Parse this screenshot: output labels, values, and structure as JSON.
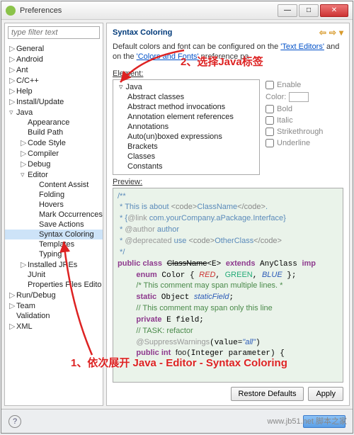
{
  "window": {
    "title": "Preferences"
  },
  "filter": {
    "placeholder": "type filter text"
  },
  "tree": [
    {
      "d": 1,
      "a": "▷",
      "t": "General"
    },
    {
      "d": 1,
      "a": "▷",
      "t": "Android"
    },
    {
      "d": 1,
      "a": "▷",
      "t": "Ant"
    },
    {
      "d": 1,
      "a": "▷",
      "t": "C/C++"
    },
    {
      "d": 1,
      "a": "▷",
      "t": "Help"
    },
    {
      "d": 1,
      "a": "▷",
      "t": "Install/Update"
    },
    {
      "d": 1,
      "a": "▿",
      "t": "Java"
    },
    {
      "d": 2,
      "a": "",
      "t": "Appearance"
    },
    {
      "d": 2,
      "a": "",
      "t": "Build Path"
    },
    {
      "d": 2,
      "a": "▷",
      "t": "Code Style"
    },
    {
      "d": 2,
      "a": "▷",
      "t": "Compiler"
    },
    {
      "d": 2,
      "a": "▷",
      "t": "Debug"
    },
    {
      "d": 2,
      "a": "▿",
      "t": "Editor"
    },
    {
      "d": 3,
      "a": "",
      "t": "Content Assist"
    },
    {
      "d": 3,
      "a": "",
      "t": "Folding"
    },
    {
      "d": 3,
      "a": "",
      "t": "Hovers"
    },
    {
      "d": 3,
      "a": "",
      "t": "Mark Occurrences"
    },
    {
      "d": 3,
      "a": "",
      "t": "Save Actions"
    },
    {
      "d": 3,
      "a": "",
      "t": "Syntax Coloring",
      "sel": true
    },
    {
      "d": 3,
      "a": "",
      "t": "Templates"
    },
    {
      "d": 3,
      "a": "",
      "t": "Typing"
    },
    {
      "d": 2,
      "a": "▷",
      "t": "Installed JREs"
    },
    {
      "d": 2,
      "a": "",
      "t": "JUnit"
    },
    {
      "d": 2,
      "a": "",
      "t": "Properties Files Edito"
    },
    {
      "d": 1,
      "a": "▷",
      "t": "Run/Debug"
    },
    {
      "d": 1,
      "a": "▷",
      "t": "Team"
    },
    {
      "d": 1,
      "a": "",
      "t": "Validation"
    },
    {
      "d": 1,
      "a": "▷",
      "t": "XML"
    }
  ],
  "main": {
    "heading": "Syntax Coloring",
    "desc1": "Default colors and font can be configured on the ",
    "link1": "'Text Editors'",
    "desc2": " and on the ",
    "link2": "'Colors and Fonts'",
    "desc3": " preference pa",
    "elementLabel": "Element:",
    "previewLabel": "Preview:",
    "elements": [
      "Java",
      "Abstract classes",
      "Abstract method invocations",
      "Annotation element references",
      "Annotations",
      "Auto(un)boxed expressions",
      "Brackets",
      "Classes",
      "Constants"
    ],
    "opts": {
      "enable": "Enable",
      "color": "Color:",
      "bold": "Bold",
      "italic": "Italic",
      "strike": "Strikethrough",
      "under": "Underline"
    }
  },
  "buttons": {
    "restore": "Restore Defaults",
    "apply": "Apply"
  },
  "anno1": "2、选择Java标签",
  "anno2": "1、依次展开 Java - Editor - Syntax Coloring",
  "watermark": "www.jb51.net 脚本之家"
}
